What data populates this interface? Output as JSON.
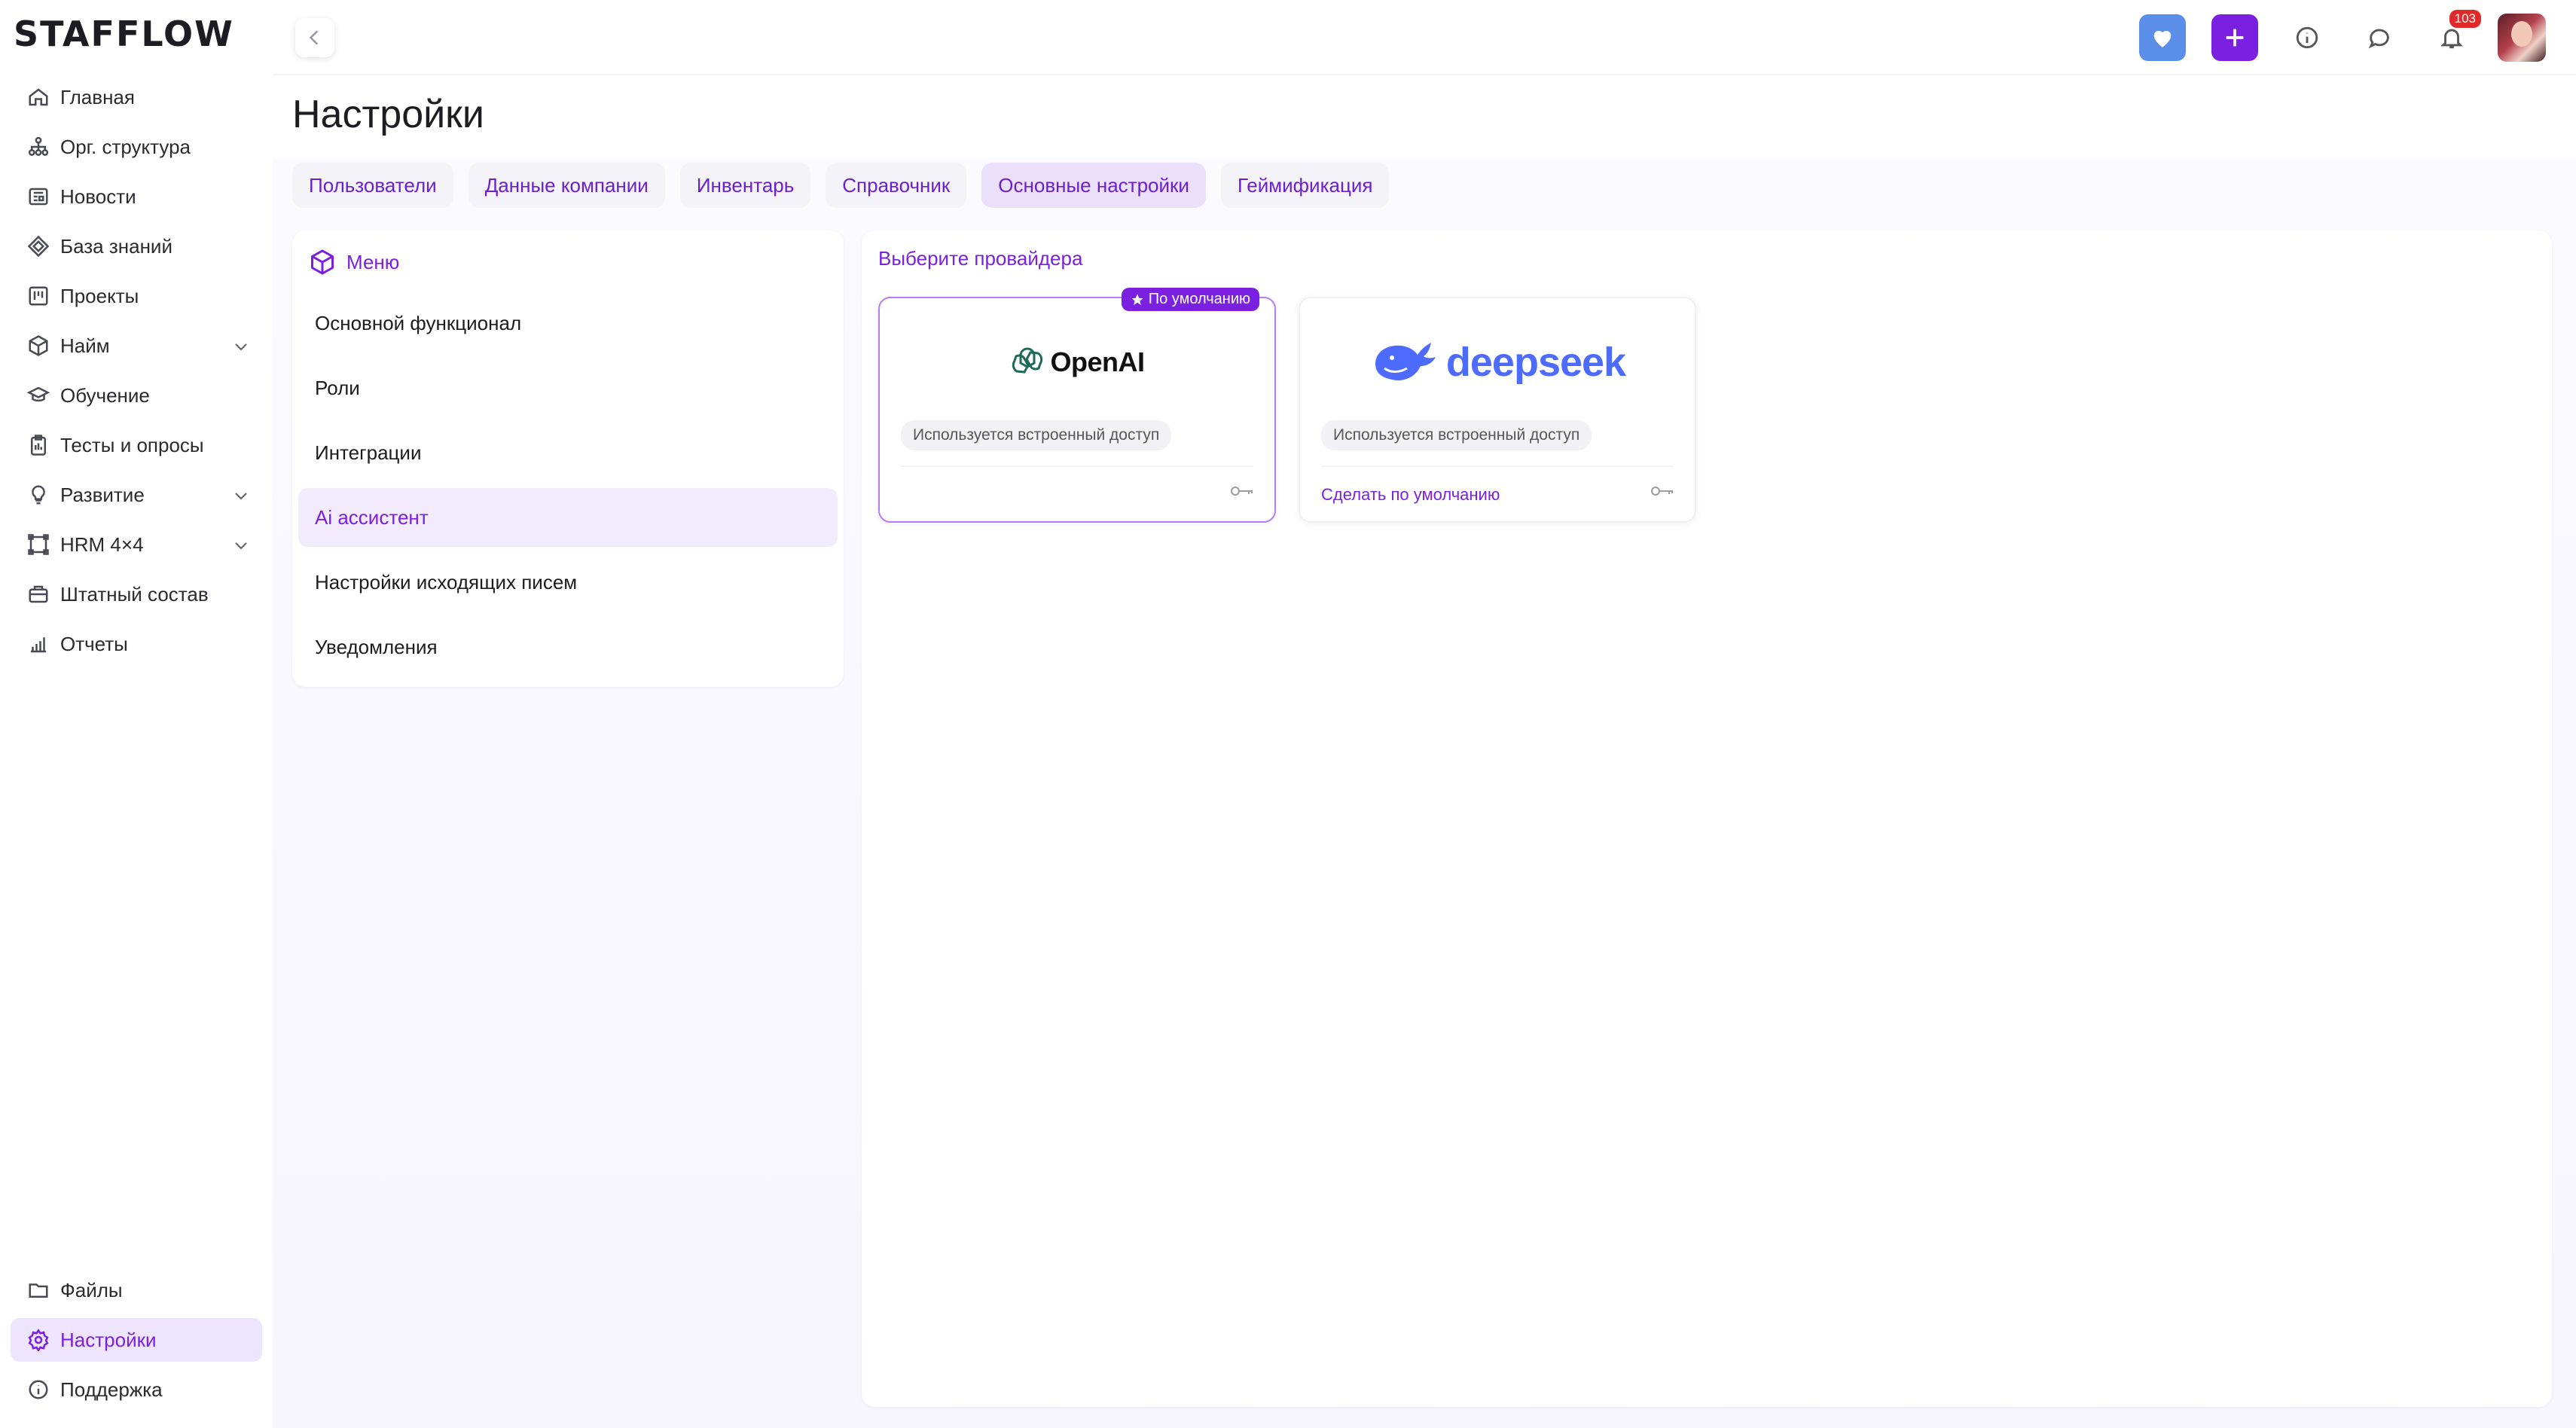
{
  "brand": {
    "name": "STAFFLOW"
  },
  "sidebar": {
    "items": [
      {
        "label": "Главная",
        "icon": "home-icon"
      },
      {
        "label": "Орг. структура",
        "icon": "org-structure-icon"
      },
      {
        "label": "Новости",
        "icon": "news-icon"
      },
      {
        "label": "База знаний",
        "icon": "knowledge-base-icon"
      },
      {
        "label": "Проекты",
        "icon": "kanban-icon"
      },
      {
        "label": "Найм",
        "icon": "box-icon",
        "expandable": true
      },
      {
        "label": "Обучение",
        "icon": "graduation-cap-icon"
      },
      {
        "label": "Тесты и опросы",
        "icon": "clipboard-icon"
      },
      {
        "label": "Развитие",
        "icon": "lightbulb-icon",
        "expandable": true
      },
      {
        "label": "HRM 4×4",
        "icon": "frame-icon",
        "expandable": true
      },
      {
        "label": "Штатный состав",
        "icon": "staff-icon"
      },
      {
        "label": "Отчеты",
        "icon": "bar-chart-icon"
      }
    ],
    "bottom_items": [
      {
        "label": "Файлы",
        "icon": "folder-icon"
      },
      {
        "label": "Настройки",
        "icon": "gear-icon",
        "active": true
      },
      {
        "label": "Поддержка",
        "icon": "info-icon"
      }
    ]
  },
  "header": {
    "notifications_count": "103",
    "accent_color": "#7b1fe0",
    "heart_button_color": "#5b8ee8"
  },
  "page": {
    "title": "Настройки",
    "tabs": [
      {
        "label": "Пользователи"
      },
      {
        "label": "Данные компании"
      },
      {
        "label": "Инвентарь"
      },
      {
        "label": "Справочник"
      },
      {
        "label": "Основные настройки",
        "active": true
      },
      {
        "label": "Геймификация"
      }
    ]
  },
  "menu": {
    "title": "Меню",
    "items": [
      {
        "label": "Основной функционал"
      },
      {
        "label": "Роли"
      },
      {
        "label": "Интеграции"
      },
      {
        "label": "Ai ассистент",
        "active": true
      },
      {
        "label": "Настройки исходящих писем"
      },
      {
        "label": "Уведомления"
      }
    ]
  },
  "providers": {
    "title": "Выберите провайдера",
    "cards": [
      {
        "name": "OpenAI",
        "default_badge": "По умолчанию",
        "status": "Используется встроенный доступ",
        "selected": true
      },
      {
        "name": "deepseek",
        "status": "Используется встроенный доступ",
        "make_default": "Сделать по умолчанию",
        "selected": false
      }
    ]
  }
}
